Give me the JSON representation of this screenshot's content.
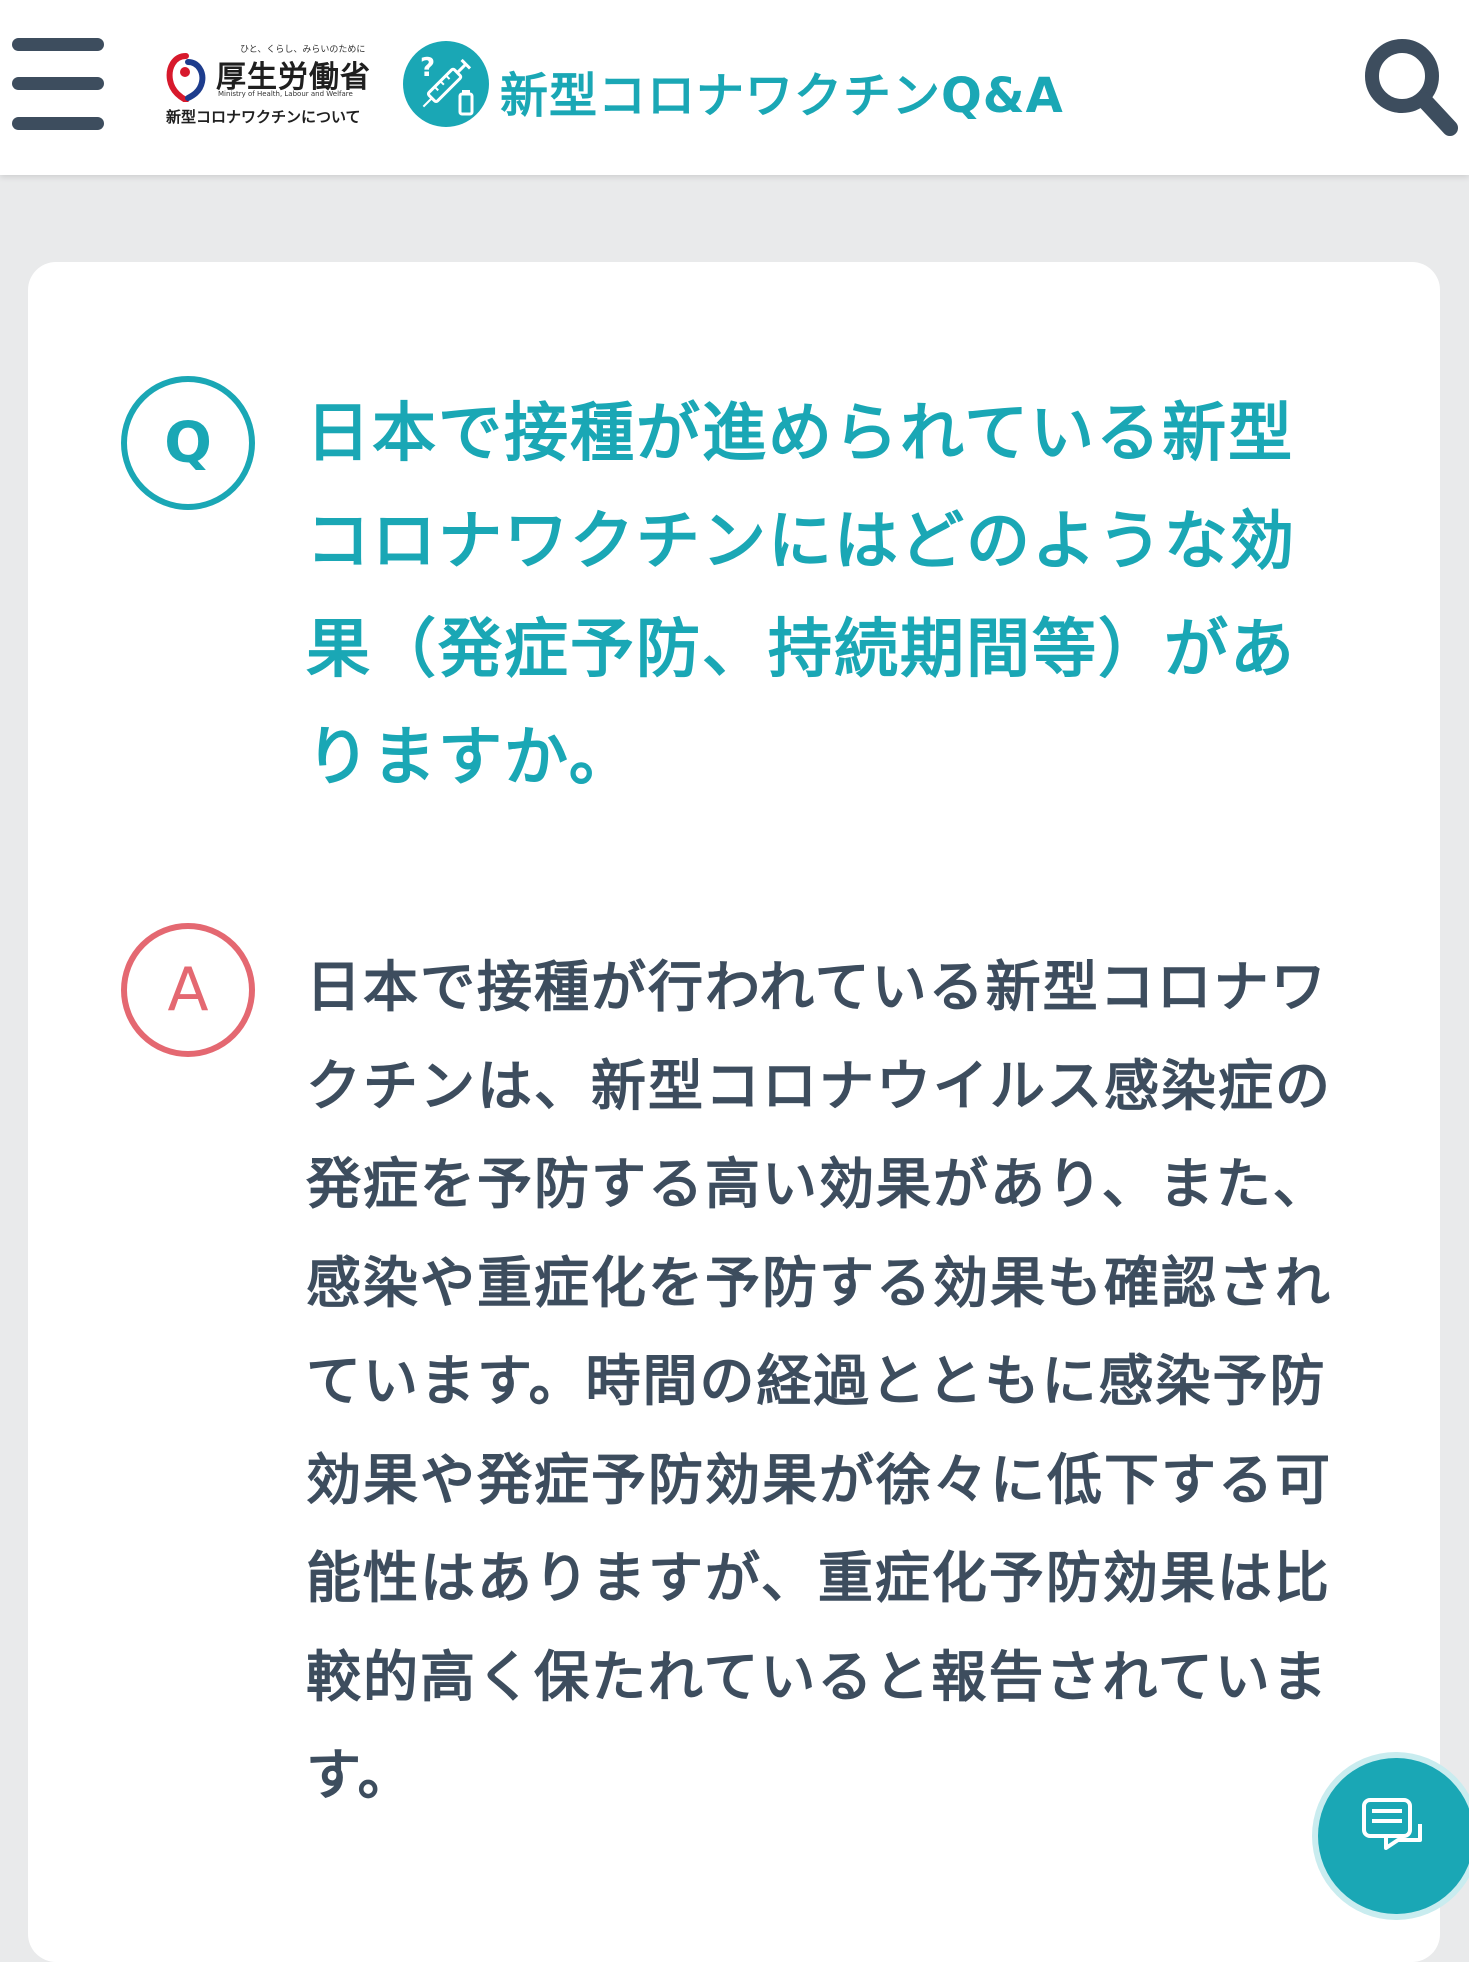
{
  "header": {
    "menu_icon": "hamburger-menu-icon",
    "ministry_logo": {
      "tagline": "ひと、くらし、みらいのために",
      "name": "厚生労働省",
      "english": "Ministry of Health, Labour and Welfare",
      "subtitle": "新型コロナワクチンについて",
      "colors": {
        "red": "#d7192c",
        "blue": "#1d3c8d"
      }
    },
    "brand_icon": "vaccine-syringe-icon",
    "site_title": "新型コロナワクチンQ&A",
    "search_icon": "search-icon"
  },
  "qa": {
    "q_label": "Q",
    "question": "日本で接種が進められている新型コロナワクチンにはどのような効果（発症予防、持続期間等）がありますか。",
    "a_label": "A",
    "answer": "日本で接種が行われている新型コロナワクチンは、新型コロナウイルス感染症の発症を予防する高い効果があり、また、感染や重症化を予防する効果も確認されています。時間の経過とともに感染予防効果や発症予防効果が徐々に低下する可能性はありますが、重症化予防効果は比較的高く保たれていると報告されています。"
  },
  "chat": {
    "icon": "chat-bubble-icon"
  },
  "colors": {
    "teal": "#1aa7b5",
    "coral": "#e46871",
    "text_dark": "#3d4d5e",
    "background": "#e9eaeb"
  }
}
